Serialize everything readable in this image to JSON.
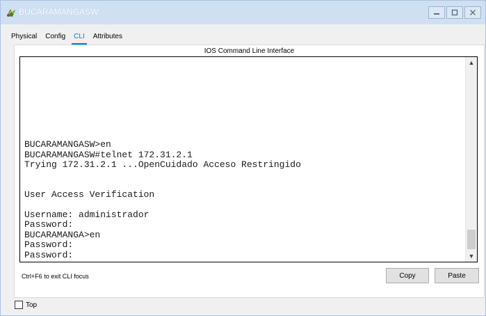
{
  "window": {
    "title": "BUCARAMANGASW",
    "controls": [
      "minimize",
      "maximize",
      "close"
    ]
  },
  "tabs": [
    {
      "label": "Physical",
      "active": false
    },
    {
      "label": "Config",
      "active": false
    },
    {
      "label": "CLI",
      "active": true
    },
    {
      "label": "Attributes",
      "active": false
    }
  ],
  "panel": {
    "header": "IOS Command Line Interface",
    "cli_output": "BUCARAMANGASW>en\nBUCARAMANGASW#telnet 172.31.2.1\nTrying 172.31.2.1 ...OpenCuidado Acceso Restringido\n\n\nUser Access Verification\n\nUsername: administrador\nPassword:\nBUCARAMANGA>en\nPassword:\nPassword:",
    "hint": "Ctrl+F6 to exit CLI focus",
    "copy_label": "Copy",
    "paste_label": "Paste"
  },
  "footer": {
    "top_label": "Top",
    "top_checked": false
  },
  "colors": {
    "accent": "#0078d7",
    "titlebar": "#cfe0f3"
  }
}
